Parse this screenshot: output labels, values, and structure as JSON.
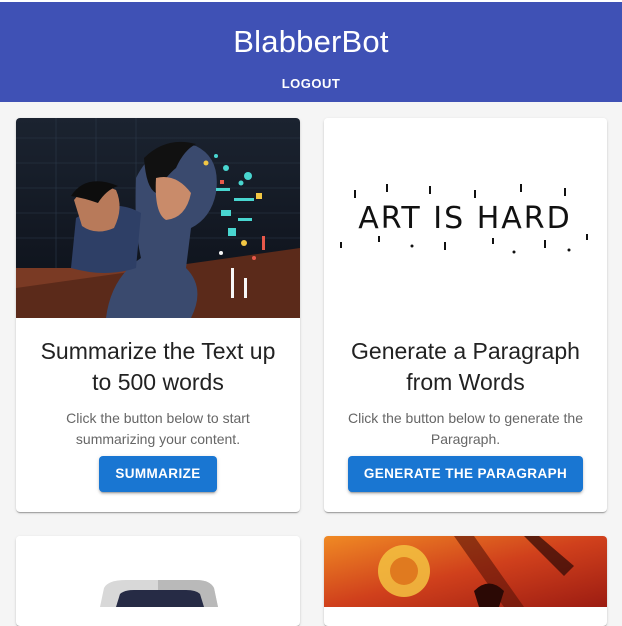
{
  "app": {
    "title": "BlabberBot",
    "logout_label": "LOGOUT"
  },
  "cards": [
    {
      "title": "Summarize the Text up to 500 words",
      "description": "Click the button below to start summarizing your content.",
      "button_label": "SUMMARIZE"
    },
    {
      "image_text": "ART IS HARD",
      "title": "Generate a Paragraph from Words",
      "description": "Click the button below to generate the Paragraph.",
      "button_label": "GENERATE THE PARAGRAPH"
    }
  ],
  "colors": {
    "appbar": "#3f51b5",
    "button": "#1976d2",
    "background": "#f5f5f5"
  }
}
